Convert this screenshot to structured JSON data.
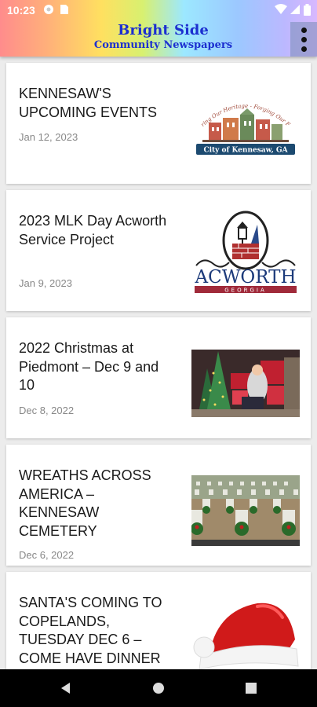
{
  "status_bar": {
    "time": "10:23"
  },
  "app_bar": {
    "title_line1": "Bright Side",
    "title_line2": "Community Newspapers"
  },
  "articles": [
    {
      "title": "KENNESAW'S UPCOMING EVENTS",
      "date": "Jan 12, 2023",
      "thumbnail": {
        "type": "logo",
        "text_top": "Honoring Our Heritage - Forging Our Future",
        "text_banner": "City of Kennesaw, GA"
      }
    },
    {
      "title": "2023 MLK Day Acworth Service Project",
      "date": "Jan 9, 2023",
      "thumbnail": {
        "type": "logo",
        "text_main": "ACWORTH",
        "text_sub": "GEORGIA"
      }
    },
    {
      "title": "2022 Christmas at Piedmont – Dec 9 and 10",
      "date": "Dec 8, 2022",
      "thumbnail": {
        "type": "photo",
        "subject": "santa-christmas-scene"
      }
    },
    {
      "title": "WREATHS ACROSS AMERICA – KENNESAW CEMETERY",
      "date": "Dec 6, 2022",
      "thumbnail": {
        "type": "photo",
        "subject": "cemetery-wreaths"
      }
    },
    {
      "title": "SANTA'S COMING TO COPELANDS, TUESDAY DEC 6 – COME HAVE DINNER",
      "date": "",
      "thumbnail": {
        "type": "illustration",
        "subject": "santa-hat"
      }
    }
  ],
  "colors": {
    "brand_text": "#1c2fd0",
    "card_bg": "#ffffff",
    "feed_bg": "#ececec",
    "date_text": "#888888"
  }
}
